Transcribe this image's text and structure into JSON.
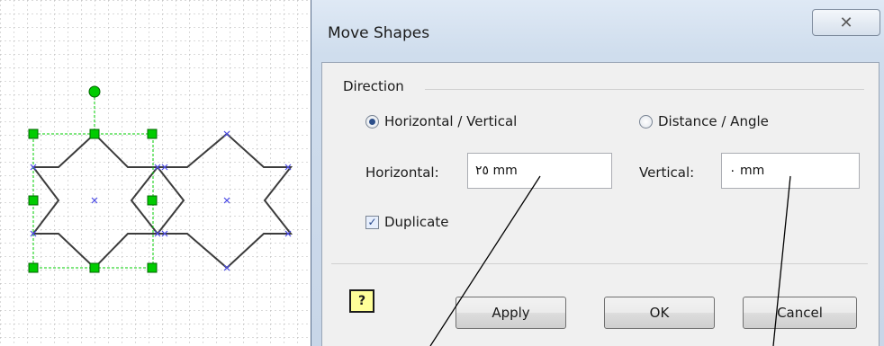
{
  "dialog": {
    "title": "Move Shapes",
    "close_glyph": "✕",
    "direction_group": {
      "label": "Direction",
      "options": [
        {
          "label": "Horizontal / Vertical",
          "selected": true
        },
        {
          "label": "Distance / Angle",
          "selected": false
        }
      ]
    },
    "horizontal": {
      "label": "Horizontal:",
      "value": "٢٥ mm"
    },
    "vertical": {
      "label": "Vertical:",
      "value": "٠ mm"
    },
    "duplicate": {
      "label": "Duplicate",
      "checked": true
    },
    "help_glyph": "?",
    "buttons": {
      "apply": "Apply",
      "ok": "OK",
      "cancel": "Cancel"
    }
  },
  "colors": {
    "handle_green": "#00cc00",
    "connection_blue": "#4a4ae6",
    "shape_stroke": "#3c3c3c"
  }
}
